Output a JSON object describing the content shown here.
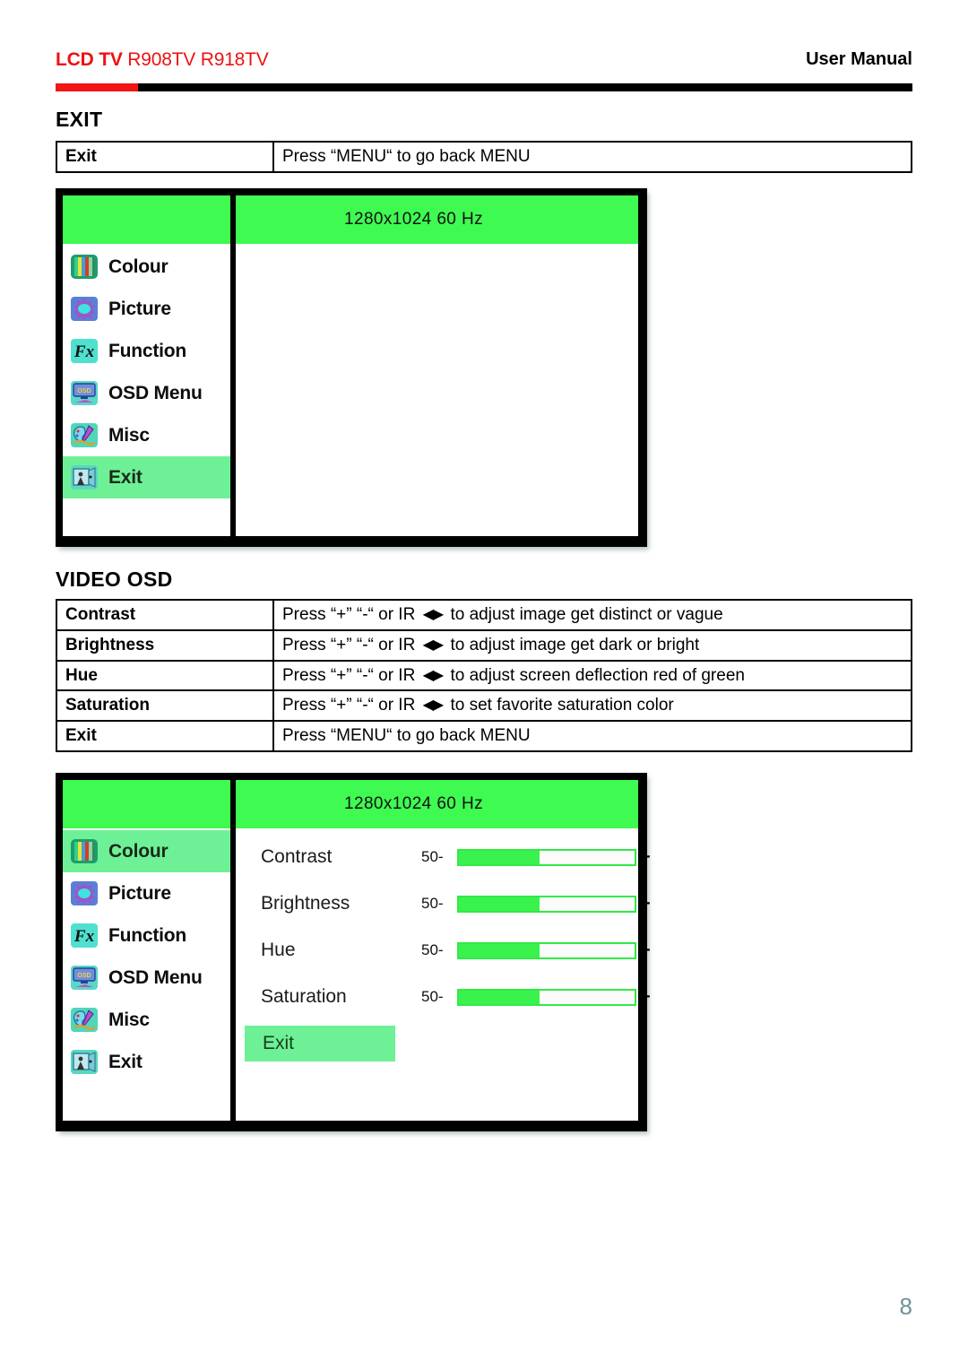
{
  "header": {
    "brand": "LCD TV",
    "models": "R908TV R918TV",
    "manual_label": "User Manual",
    "accent_red": "#f21616",
    "bar_black": "#000000"
  },
  "sections": [
    {
      "id": "exit",
      "title": "EXIT"
    },
    {
      "id": "video",
      "title": "VIDEO OSD"
    }
  ],
  "exit_table": {
    "rows": [
      {
        "label": "Exit",
        "desc": "Press “MENU“ to go back MENU",
        "has_arrows": false
      }
    ]
  },
  "video_table": {
    "rows": [
      {
        "label": "Contrast",
        "desc_pre": "Press “+” “-“ or IR ",
        "arrows": "◀▶",
        "desc_post": " to adjust image get distinct or vague",
        "has_arrows": true
      },
      {
        "label": "Brightness",
        "desc_pre": "Press “+” “-“ or IR ",
        "arrows": "◀▶",
        "desc_post": " to adjust image get dark or bright",
        "has_arrows": true
      },
      {
        "label": "Hue",
        "desc_pre": "Press “+” “-“ or IR ",
        "arrows": "◀▶",
        "desc_post": " to adjust screen deflection red of green",
        "has_arrows": true
      },
      {
        "label": "Saturation",
        "desc_pre": "Press “+” “-“ or IR ",
        "arrows": "◀▶",
        "desc_post": " to set favorite saturation color",
        "has_arrows": true
      },
      {
        "label": "Exit",
        "desc_pre": "Press “MENU“ to go back MENU",
        "arrows": "",
        "desc_post": "",
        "has_arrows": false
      }
    ]
  },
  "osd_exit": {
    "resolution": "1280x1024  60 Hz",
    "menu_items": [
      {
        "label": "Colour",
        "icon": "colour-bars-icon",
        "selected": false
      },
      {
        "label": "Picture",
        "icon": "picture-sun-icon",
        "selected": false
      },
      {
        "label": "Function",
        "icon": "function-fx-icon",
        "selected": false
      },
      {
        "label": "OSD Menu",
        "icon": "osd-monitor-icon",
        "selected": false
      },
      {
        "label": "Misc",
        "icon": "misc-palette-icon",
        "selected": false
      },
      {
        "label": "Exit",
        "icon": "exit-door-icon",
        "selected": true
      }
    ],
    "options": []
  },
  "osd_video": {
    "resolution": "1280x1024  60 Hz",
    "menu_items": [
      {
        "label": "Colour",
        "icon": "colour-bars-icon",
        "selected": true
      },
      {
        "label": "Picture",
        "icon": "picture-sun-icon",
        "selected": false
      },
      {
        "label": "Function",
        "icon": "function-fx-icon",
        "selected": false
      },
      {
        "label": "OSD Menu",
        "icon": "osd-monitor-icon",
        "selected": false
      },
      {
        "label": "Misc",
        "icon": "misc-palette-icon",
        "selected": false
      },
      {
        "label": "Exit",
        "icon": "exit-door-icon",
        "selected": false
      }
    ],
    "options": [
      {
        "name": "Contrast",
        "value": "50-",
        "fill_percent": 46,
        "plus": "+"
      },
      {
        "name": "Brightness",
        "value": "50-",
        "fill_percent": 46,
        "plus": "+"
      },
      {
        "name": "Hue",
        "value": "50-",
        "fill_percent": 46,
        "plus": "+"
      },
      {
        "name": "Saturation",
        "value": "50-",
        "fill_percent": 46,
        "plus": "+"
      }
    ],
    "exit_option": "Exit"
  },
  "colors": {
    "osd_header_green": "#3efa51",
    "osd_highlight_green": "#6ef196",
    "slider_fill_green": "#39f24d",
    "page_number_color": "#6d9399"
  },
  "footer": {
    "page_number": "8"
  }
}
